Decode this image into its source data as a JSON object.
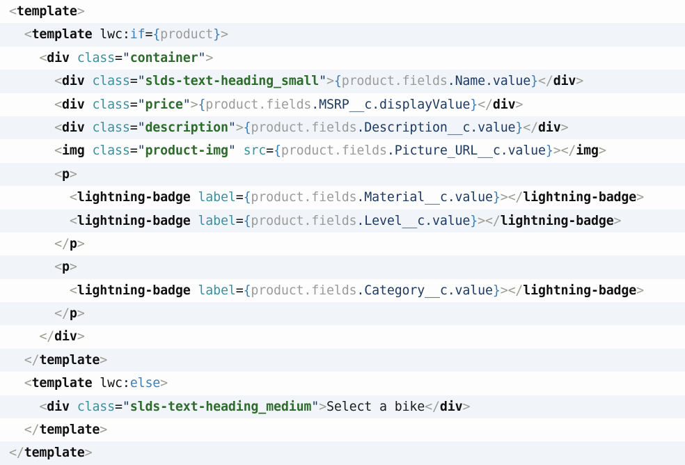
{
  "editor": {
    "language": "html",
    "file_kind": "lwc-template",
    "font_size_px": 18,
    "line_count": 20,
    "indent_unit_spaces": 2,
    "colors": {
      "background_odd": "#fdfdfd",
      "background_even": "#f1f5fa",
      "bracket": "#9c9c93",
      "tag": "#101010",
      "attribute": "#3d8f9e",
      "keyword": "#3c7eb5",
      "string": "#2e6b2c",
      "quote": "#17355c",
      "brace": "#3c7eb5",
      "object_path": "#9b9b9b",
      "property": "#1d3a63",
      "plain_text": "#1b1b1b"
    }
  },
  "code": {
    "lines": [
      {
        "n": 1,
        "indent": 0,
        "text": "<template>"
      },
      {
        "n": 2,
        "indent": 1,
        "text": "<template lwc:if={product}>"
      },
      {
        "n": 3,
        "indent": 2,
        "text": "<div class=\"container\">"
      },
      {
        "n": 4,
        "indent": 3,
        "text": "<div class=\"slds-text-heading_small\">{product.fields.Name.value}</div>"
      },
      {
        "n": 5,
        "indent": 3,
        "text": "<div class=\"price\">{product.fields.MSRP__c.displayValue}</div>"
      },
      {
        "n": 6,
        "indent": 3,
        "text": "<div class=\"description\">{product.fields.Description__c.value}</div>"
      },
      {
        "n": 7,
        "indent": 3,
        "text": "<img class=\"product-img\" src={product.fields.Picture_URL__c.value}></img>"
      },
      {
        "n": 8,
        "indent": 3,
        "text": "<p>"
      },
      {
        "n": 9,
        "indent": 4,
        "text": "<lightning-badge label={product.fields.Material__c.value}></lightning-badge>"
      },
      {
        "n": 10,
        "indent": 4,
        "text": "<lightning-badge label={product.fields.Level__c.value}></lightning-badge>"
      },
      {
        "n": 11,
        "indent": 3,
        "text": "</p>"
      },
      {
        "n": 12,
        "indent": 3,
        "text": "<p>"
      },
      {
        "n": 13,
        "indent": 4,
        "text": "<lightning-badge label={product.fields.Category__c.value}></lightning-badge>"
      },
      {
        "n": 14,
        "indent": 3,
        "text": "</p>"
      },
      {
        "n": 15,
        "indent": 2,
        "text": "</div>"
      },
      {
        "n": 16,
        "indent": 1,
        "text": "</template>"
      },
      {
        "n": 17,
        "indent": 1,
        "text": "<template lwc:else>"
      },
      {
        "n": 18,
        "indent": 2,
        "text": "<div class=\"slds-text-heading_medium\">Select a bike</div>"
      },
      {
        "n": 19,
        "indent": 1,
        "text": "</template>"
      },
      {
        "n": 20,
        "indent": 0,
        "text": "</template>"
      }
    ],
    "tokens": [
      [
        {
          "t": "<",
          "c": "t-bracket"
        },
        {
          "t": "template",
          "c": "t-tag"
        },
        {
          "t": ">",
          "c": "t-bracket"
        }
      ],
      [
        {
          "t": "<",
          "c": "t-bracket"
        },
        {
          "t": "template",
          "c": "t-tag"
        },
        {
          "t": " ",
          "c": "t-text"
        },
        {
          "t": "lwc",
          "c": "t-ns"
        },
        {
          "t": ":",
          "c": "t-colon"
        },
        {
          "t": "if",
          "c": "t-kw"
        },
        {
          "t": "=",
          "c": "t-eq"
        },
        {
          "t": "{",
          "c": "t-brace"
        },
        {
          "t": "product",
          "c": "t-obj"
        },
        {
          "t": "}",
          "c": "t-brace"
        },
        {
          "t": ">",
          "c": "t-bracket"
        }
      ],
      [
        {
          "t": "<",
          "c": "t-bracket"
        },
        {
          "t": "div",
          "c": "t-tag"
        },
        {
          "t": " ",
          "c": "t-text"
        },
        {
          "t": "class",
          "c": "t-attr"
        },
        {
          "t": "=",
          "c": "t-eq"
        },
        {
          "t": "\"",
          "c": "t-quote"
        },
        {
          "t": "container",
          "c": "t-str"
        },
        {
          "t": "\"",
          "c": "t-quote"
        },
        {
          "t": ">",
          "c": "t-bracket"
        }
      ],
      [
        {
          "t": "<",
          "c": "t-bracket"
        },
        {
          "t": "div",
          "c": "t-tag"
        },
        {
          "t": " ",
          "c": "t-text"
        },
        {
          "t": "class",
          "c": "t-attr"
        },
        {
          "t": "=",
          "c": "t-eq"
        },
        {
          "t": "\"",
          "c": "t-quote"
        },
        {
          "t": "slds-text-heading_small",
          "c": "t-str"
        },
        {
          "t": "\"",
          "c": "t-quote"
        },
        {
          "t": ">",
          "c": "t-bracket"
        },
        {
          "t": "{",
          "c": "t-brace"
        },
        {
          "t": "product.fields",
          "c": "t-obj"
        },
        {
          "t": ".Name.value",
          "c": "t-prop"
        },
        {
          "t": "}",
          "c": "t-brace"
        },
        {
          "t": "</",
          "c": "t-bracket"
        },
        {
          "t": "div",
          "c": "t-tag"
        },
        {
          "t": ">",
          "c": "t-bracket"
        }
      ],
      [
        {
          "t": "<",
          "c": "t-bracket"
        },
        {
          "t": "div",
          "c": "t-tag"
        },
        {
          "t": " ",
          "c": "t-text"
        },
        {
          "t": "class",
          "c": "t-attr"
        },
        {
          "t": "=",
          "c": "t-eq"
        },
        {
          "t": "\"",
          "c": "t-quote"
        },
        {
          "t": "price",
          "c": "t-str"
        },
        {
          "t": "\"",
          "c": "t-quote"
        },
        {
          "t": ">",
          "c": "t-bracket"
        },
        {
          "t": "{",
          "c": "t-brace"
        },
        {
          "t": "product.fields",
          "c": "t-obj"
        },
        {
          "t": ".MSRP__c.displayValue",
          "c": "t-prop"
        },
        {
          "t": "}",
          "c": "t-brace"
        },
        {
          "t": "</",
          "c": "t-bracket"
        },
        {
          "t": "div",
          "c": "t-tag"
        },
        {
          "t": ">",
          "c": "t-bracket"
        }
      ],
      [
        {
          "t": "<",
          "c": "t-bracket"
        },
        {
          "t": "div",
          "c": "t-tag"
        },
        {
          "t": " ",
          "c": "t-text"
        },
        {
          "t": "class",
          "c": "t-attr"
        },
        {
          "t": "=",
          "c": "t-eq"
        },
        {
          "t": "\"",
          "c": "t-quote"
        },
        {
          "t": "description",
          "c": "t-str"
        },
        {
          "t": "\"",
          "c": "t-quote"
        },
        {
          "t": ">",
          "c": "t-bracket"
        },
        {
          "t": "{",
          "c": "t-brace"
        },
        {
          "t": "product.fields",
          "c": "t-obj"
        },
        {
          "t": ".Description__c.value",
          "c": "t-prop"
        },
        {
          "t": "}",
          "c": "t-brace"
        },
        {
          "t": "</",
          "c": "t-bracket"
        },
        {
          "t": "div",
          "c": "t-tag"
        },
        {
          "t": ">",
          "c": "t-bracket"
        }
      ],
      [
        {
          "t": "<",
          "c": "t-bracket"
        },
        {
          "t": "img",
          "c": "t-tag"
        },
        {
          "t": " ",
          "c": "t-text"
        },
        {
          "t": "class",
          "c": "t-attr"
        },
        {
          "t": "=",
          "c": "t-eq"
        },
        {
          "t": "\"",
          "c": "t-quote"
        },
        {
          "t": "product-img",
          "c": "t-str"
        },
        {
          "t": "\"",
          "c": "t-quote"
        },
        {
          "t": " ",
          "c": "t-text"
        },
        {
          "t": "src",
          "c": "t-attr"
        },
        {
          "t": "=",
          "c": "t-eq"
        },
        {
          "t": "{",
          "c": "t-brace"
        },
        {
          "t": "product.fields",
          "c": "t-obj"
        },
        {
          "t": ".Picture_URL__c.value",
          "c": "t-prop"
        },
        {
          "t": "}",
          "c": "t-brace"
        },
        {
          "t": ">",
          "c": "t-bracket"
        },
        {
          "t": "</",
          "c": "t-bracket"
        },
        {
          "t": "img",
          "c": "t-tag"
        },
        {
          "t": ">",
          "c": "t-bracket"
        }
      ],
      [
        {
          "t": "<",
          "c": "t-bracket"
        },
        {
          "t": "p",
          "c": "t-tag"
        },
        {
          "t": ">",
          "c": "t-bracket"
        }
      ],
      [
        {
          "t": "<",
          "c": "t-bracket"
        },
        {
          "t": "lightning-badge",
          "c": "t-tag"
        },
        {
          "t": " ",
          "c": "t-text"
        },
        {
          "t": "label",
          "c": "t-attr"
        },
        {
          "t": "=",
          "c": "t-eq"
        },
        {
          "t": "{",
          "c": "t-brace"
        },
        {
          "t": "product.fields",
          "c": "t-obj"
        },
        {
          "t": ".Material__c.value",
          "c": "t-prop"
        },
        {
          "t": "}",
          "c": "t-brace"
        },
        {
          "t": ">",
          "c": "t-bracket"
        },
        {
          "t": "</",
          "c": "t-bracket"
        },
        {
          "t": "lightning-badge",
          "c": "t-tag"
        },
        {
          "t": ">",
          "c": "t-bracket"
        }
      ],
      [
        {
          "t": "<",
          "c": "t-bracket"
        },
        {
          "t": "lightning-badge",
          "c": "t-tag"
        },
        {
          "t": " ",
          "c": "t-text"
        },
        {
          "t": "label",
          "c": "t-attr"
        },
        {
          "t": "=",
          "c": "t-eq"
        },
        {
          "t": "{",
          "c": "t-brace"
        },
        {
          "t": "product.fields",
          "c": "t-obj"
        },
        {
          "t": ".Level__c.value",
          "c": "t-prop"
        },
        {
          "t": "}",
          "c": "t-brace"
        },
        {
          "t": ">",
          "c": "t-bracket"
        },
        {
          "t": "</",
          "c": "t-bracket"
        },
        {
          "t": "lightning-badge",
          "c": "t-tag"
        },
        {
          "t": ">",
          "c": "t-bracket"
        }
      ],
      [
        {
          "t": "</",
          "c": "t-bracket"
        },
        {
          "t": "p",
          "c": "t-tag"
        },
        {
          "t": ">",
          "c": "t-bracket"
        }
      ],
      [
        {
          "t": "<",
          "c": "t-bracket"
        },
        {
          "t": "p",
          "c": "t-tag"
        },
        {
          "t": ">",
          "c": "t-bracket"
        }
      ],
      [
        {
          "t": "<",
          "c": "t-bracket"
        },
        {
          "t": "lightning-badge",
          "c": "t-tag"
        },
        {
          "t": " ",
          "c": "t-text"
        },
        {
          "t": "label",
          "c": "t-attr"
        },
        {
          "t": "=",
          "c": "t-eq"
        },
        {
          "t": "{",
          "c": "t-brace"
        },
        {
          "t": "product.fields",
          "c": "t-obj"
        },
        {
          "t": ".Category__c.value",
          "c": "t-prop"
        },
        {
          "t": "}",
          "c": "t-brace"
        },
        {
          "t": ">",
          "c": "t-bracket"
        },
        {
          "t": "</",
          "c": "t-bracket"
        },
        {
          "t": "lightning-badge",
          "c": "t-tag"
        },
        {
          "t": ">",
          "c": "t-bracket"
        }
      ],
      [
        {
          "t": "</",
          "c": "t-bracket"
        },
        {
          "t": "p",
          "c": "t-tag"
        },
        {
          "t": ">",
          "c": "t-bracket"
        }
      ],
      [
        {
          "t": "</",
          "c": "t-bracket"
        },
        {
          "t": "div",
          "c": "t-tag"
        },
        {
          "t": ">",
          "c": "t-bracket"
        }
      ],
      [
        {
          "t": "</",
          "c": "t-bracket"
        },
        {
          "t": "template",
          "c": "t-tag"
        },
        {
          "t": ">",
          "c": "t-bracket"
        }
      ],
      [
        {
          "t": "<",
          "c": "t-bracket"
        },
        {
          "t": "template",
          "c": "t-tag"
        },
        {
          "t": " ",
          "c": "t-text"
        },
        {
          "t": "lwc",
          "c": "t-ns"
        },
        {
          "t": ":",
          "c": "t-colon"
        },
        {
          "t": "else",
          "c": "t-kw"
        },
        {
          "t": ">",
          "c": "t-bracket"
        }
      ],
      [
        {
          "t": "<",
          "c": "t-bracket"
        },
        {
          "t": "div",
          "c": "t-tag"
        },
        {
          "t": " ",
          "c": "t-text"
        },
        {
          "t": "class",
          "c": "t-attr"
        },
        {
          "t": "=",
          "c": "t-eq"
        },
        {
          "t": "\"",
          "c": "t-quote"
        },
        {
          "t": "slds-text-heading_medium",
          "c": "t-str"
        },
        {
          "t": "\"",
          "c": "t-quote"
        },
        {
          "t": ">",
          "c": "t-bracket"
        },
        {
          "t": "Select a bike",
          "c": "t-text"
        },
        {
          "t": "</",
          "c": "t-bracket"
        },
        {
          "t": "div",
          "c": "t-tag"
        },
        {
          "t": ">",
          "c": "t-bracket"
        }
      ],
      [
        {
          "t": "</",
          "c": "t-bracket"
        },
        {
          "t": "template",
          "c": "t-tag"
        },
        {
          "t": ">",
          "c": "t-bracket"
        }
      ],
      [
        {
          "t": "</",
          "c": "t-bracket"
        },
        {
          "t": "template",
          "c": "t-tag"
        },
        {
          "t": ">",
          "c": "t-bracket"
        }
      ]
    ]
  }
}
